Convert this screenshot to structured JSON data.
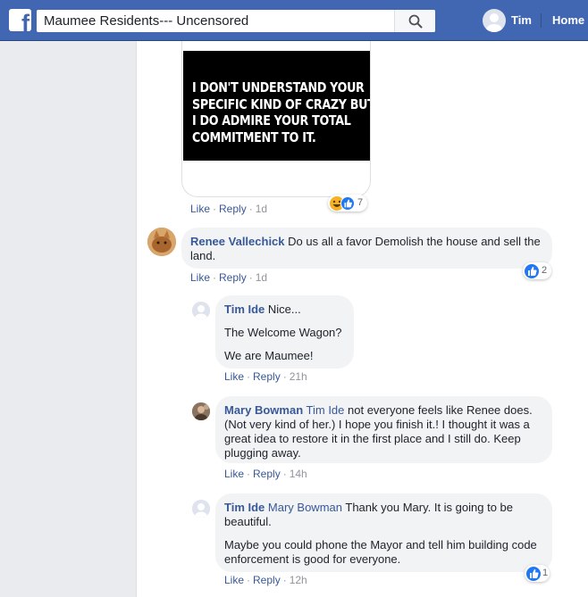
{
  "topbar": {
    "logo_letter": "f",
    "search_value": "Maumee Residents--- Uncensored",
    "user_name": "Tim",
    "home_label": "Home"
  },
  "image_post": {
    "meme_lines": [
      "I DON'T UNDERSTAND YOUR",
      "SPECIFIC KIND OF CRAZY BUT",
      "I DO ADMIRE YOUR TOTAL",
      "COMMITMENT TO IT."
    ],
    "like": "Like",
    "reply": "Reply",
    "time": "1d",
    "reaction_count": "7"
  },
  "comments": [
    {
      "author": "Renee Vallechick",
      "mention": "",
      "text": [
        "Do us all a favor Demolish the house and sell the land."
      ],
      "like": "Like",
      "reply": "Reply",
      "time": "1d",
      "reaction_count": "2"
    },
    {
      "author": "Tim Ide",
      "mention": "",
      "text": [
        "Nice...",
        "The Welcome Wagon?",
        "We are Maumee!"
      ],
      "like": "Like",
      "reply": "Reply",
      "time": "21h",
      "reaction_count": ""
    },
    {
      "author": "Mary Bowman",
      "mention": "Tim Ide",
      "text": [
        "not everyone feels like Renee does. (Not very kind of her.) I hope you finish it.! I thought it was a great idea to restore it in the first place and I still do. Keep plugging away."
      ],
      "like": "Like",
      "reply": "Reply",
      "time": "14h",
      "reaction_count": ""
    },
    {
      "author": "Tim Ide",
      "mention": "Mary Bowman",
      "text": [
        "Thank you Mary. It is going to be beautiful.",
        "Maybe you could phone the Mayor and tell him building code enforcement is good for everyone."
      ],
      "like": "Like",
      "reply": "Reply",
      "time": "12h",
      "reaction_count": "1"
    }
  ],
  "separator": "·",
  "colors": {
    "brand": "#4267b2",
    "link": "#385898",
    "bubble": "#f2f3f5",
    "like_blue": "#2078f4"
  },
  "icons": [
    "facebook-logo-icon",
    "search-icon",
    "haha-reaction-icon",
    "like-reaction-icon"
  ]
}
